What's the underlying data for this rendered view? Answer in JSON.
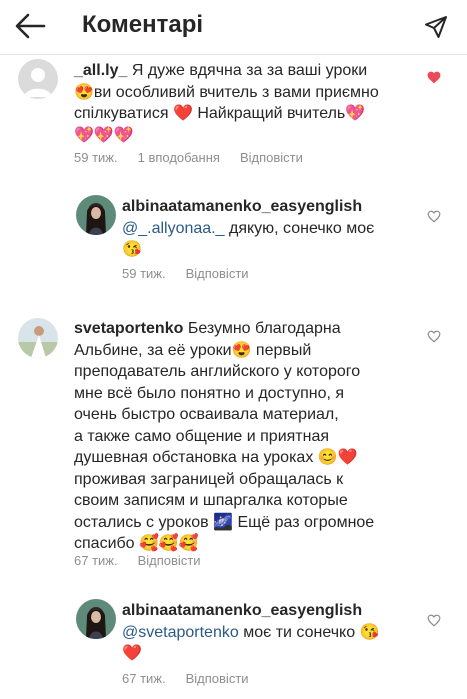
{
  "header": {
    "title": "Коментарі"
  },
  "comments": [
    {
      "username": "_all.ly_",
      "lines": [
        " Я дуже вдячна за за ваші уроки",
        "😍ви особливий вчитель з вами приємно",
        "спілкуватися ❤️ Найкращий вчитель💖",
        "💖💖💖"
      ],
      "time": "59 тиж.",
      "likes": "1 вподобання",
      "reply": "Відповісти",
      "liked": true
    },
    {
      "username": "albinaatamanenko_easyenglish",
      "mention": "@_.allyonaa._",
      "lines": [
        " дякую, сонечко моє",
        "😘"
      ],
      "time": "59 тиж.",
      "reply": "Відповісти",
      "liked": false
    },
    {
      "username": "svetaportenko",
      "lines": [
        " Безумно благодарна",
        "Альбине, за её уроки😍 первый",
        "преподаватель английского у которого",
        "мне всё было понятно и доступно, я",
        "очень быстро осваивала материал,",
        "а также само общение и приятная",
        "душевная обстановка на уроках 😊❤️",
        "проживая заграницей обращалась к",
        "своим записям и шпаргалка которые",
        "остались с уроков 🌌 Ещё раз огромное",
        "спасибо 🥰🥰🥰"
      ],
      "time": "67 тиж.",
      "reply": "Відповісти",
      "liked": false
    },
    {
      "username": "albinaatamanenko_easyenglish",
      "mention": "@svetaportenko",
      "lines": [
        " моє ти сонечко 😘",
        "❤️"
      ],
      "time": "67 тиж.",
      "reply": "Відповісти",
      "liked": false
    }
  ],
  "colors": {
    "text": "#262626",
    "meta": "#8e8e8e",
    "mention": "#2b5a87",
    "like_active": "#ed4956"
  }
}
